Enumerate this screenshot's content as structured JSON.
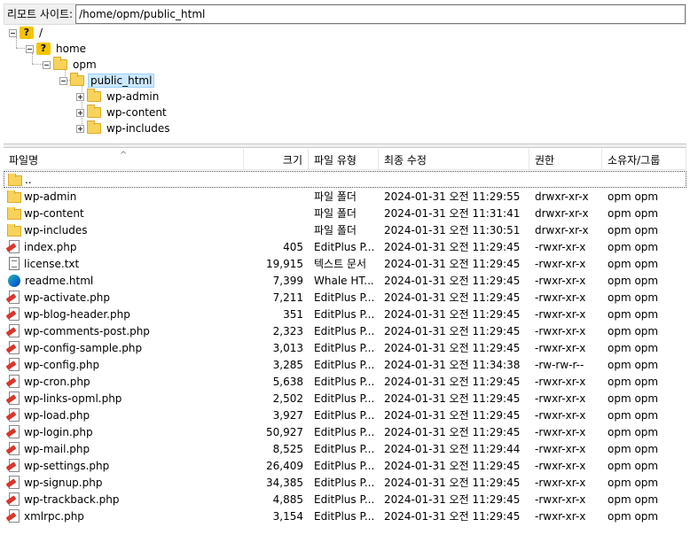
{
  "site_bar": {
    "label": "리모트 사이트:",
    "path": "/home/opm/public_html"
  },
  "tree": [
    {
      "label": "/",
      "icon": "question-folder-icon",
      "expander": "minus"
    },
    {
      "label": "home",
      "icon": "question-folder-icon",
      "expander": "minus"
    },
    {
      "label": "opm",
      "icon": "folder-icon",
      "expander": "minus"
    },
    {
      "label": "public_html",
      "icon": "folder-open-icon",
      "expander": "minus",
      "selected": true
    },
    {
      "label": "wp-admin",
      "icon": "folder-icon",
      "expander": "plus"
    },
    {
      "label": "wp-content",
      "icon": "folder-icon",
      "expander": "plus"
    },
    {
      "label": "wp-includes",
      "icon": "folder-icon",
      "expander": "plus"
    }
  ],
  "columns": {
    "name": "파일명",
    "size": "크기",
    "type": "파일 유형",
    "modified": "최종 수정",
    "perms": "권한",
    "owner": "소유자/그룹"
  },
  "parent_row": {
    "name": ".."
  },
  "files": [
    {
      "name": "wp-admin",
      "icon": "folder",
      "size": "",
      "type": "파일 폴더",
      "modified": "2024-01-31 오전 11:29:55",
      "perms": "drwxr-xr-x",
      "owner": "opm opm"
    },
    {
      "name": "wp-content",
      "icon": "folder",
      "size": "",
      "type": "파일 폴더",
      "modified": "2024-01-31 오전 11:31:41",
      "perms": "drwxr-xr-x",
      "owner": "opm opm"
    },
    {
      "name": "wp-includes",
      "icon": "folder",
      "size": "",
      "type": "파일 폴더",
      "modified": "2024-01-31 오전 11:30:51",
      "perms": "drwxr-xr-x",
      "owner": "opm opm"
    },
    {
      "name": "index.php",
      "icon": "php",
      "size": "405",
      "type": "EditPlus P...",
      "modified": "2024-01-31 오전 11:29:45",
      "perms": "-rwxr-xr-x",
      "owner": "opm opm"
    },
    {
      "name": "license.txt",
      "icon": "txt",
      "size": "19,915",
      "type": "텍스트 문서",
      "modified": "2024-01-31 오전 11:29:45",
      "perms": "-rwxr-xr-x",
      "owner": "opm opm"
    },
    {
      "name": "readme.html",
      "icon": "html",
      "size": "7,399",
      "type": "Whale HT...",
      "modified": "2024-01-31 오전 11:29:45",
      "perms": "-rwxr-xr-x",
      "owner": "opm opm"
    },
    {
      "name": "wp-activate.php",
      "icon": "php",
      "size": "7,211",
      "type": "EditPlus P...",
      "modified": "2024-01-31 오전 11:29:45",
      "perms": "-rwxr-xr-x",
      "owner": "opm opm"
    },
    {
      "name": "wp-blog-header.php",
      "icon": "php",
      "size": "351",
      "type": "EditPlus P...",
      "modified": "2024-01-31 오전 11:29:45",
      "perms": "-rwxr-xr-x",
      "owner": "opm opm"
    },
    {
      "name": "wp-comments-post.php",
      "icon": "php",
      "size": "2,323",
      "type": "EditPlus P...",
      "modified": "2024-01-31 오전 11:29:45",
      "perms": "-rwxr-xr-x",
      "owner": "opm opm"
    },
    {
      "name": "wp-config-sample.php",
      "icon": "php",
      "size": "3,013",
      "type": "EditPlus P...",
      "modified": "2024-01-31 오전 11:29:45",
      "perms": "-rwxr-xr-x",
      "owner": "opm opm"
    },
    {
      "name": "wp-config.php",
      "icon": "php",
      "size": "3,285",
      "type": "EditPlus P...",
      "modified": "2024-01-31 오전 11:34:38",
      "perms": "-rw-rw-r--",
      "owner": "opm opm"
    },
    {
      "name": "wp-cron.php",
      "icon": "php",
      "size": "5,638",
      "type": "EditPlus P...",
      "modified": "2024-01-31 오전 11:29:45",
      "perms": "-rwxr-xr-x",
      "owner": "opm opm"
    },
    {
      "name": "wp-links-opml.php",
      "icon": "php",
      "size": "2,502",
      "type": "EditPlus P...",
      "modified": "2024-01-31 오전 11:29:45",
      "perms": "-rwxr-xr-x",
      "owner": "opm opm"
    },
    {
      "name": "wp-load.php",
      "icon": "php",
      "size": "3,927",
      "type": "EditPlus P...",
      "modified": "2024-01-31 오전 11:29:45",
      "perms": "-rwxr-xr-x",
      "owner": "opm opm"
    },
    {
      "name": "wp-login.php",
      "icon": "php",
      "size": "50,927",
      "type": "EditPlus P...",
      "modified": "2024-01-31 오전 11:29:45",
      "perms": "-rwxr-xr-x",
      "owner": "opm opm"
    },
    {
      "name": "wp-mail.php",
      "icon": "php",
      "size": "8,525",
      "type": "EditPlus P...",
      "modified": "2024-01-31 오전 11:29:44",
      "perms": "-rwxr-xr-x",
      "owner": "opm opm"
    },
    {
      "name": "wp-settings.php",
      "icon": "php",
      "size": "26,409",
      "type": "EditPlus P...",
      "modified": "2024-01-31 오전 11:29:45",
      "perms": "-rwxr-xr-x",
      "owner": "opm opm"
    },
    {
      "name": "wp-signup.php",
      "icon": "php",
      "size": "34,385",
      "type": "EditPlus P...",
      "modified": "2024-01-31 오전 11:29:45",
      "perms": "-rwxr-xr-x",
      "owner": "opm opm"
    },
    {
      "name": "wp-trackback.php",
      "icon": "php",
      "size": "4,885",
      "type": "EditPlus P...",
      "modified": "2024-01-31 오전 11:29:45",
      "perms": "-rwxr-xr-x",
      "owner": "opm opm"
    },
    {
      "name": "xmlrpc.php",
      "icon": "php",
      "size": "3,154",
      "type": "EditPlus P...",
      "modified": "2024-01-31 오전 11:29:45",
      "perms": "-rwxr-xr-x",
      "owner": "opm opm"
    }
  ]
}
